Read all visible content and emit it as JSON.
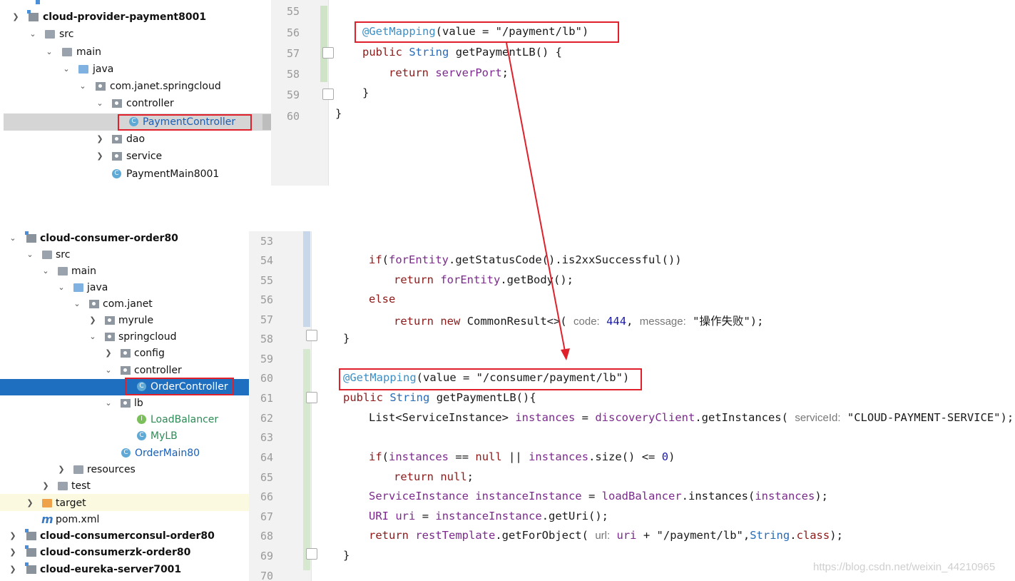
{
  "top_tree": {
    "items": [
      {
        "label": "cloud-provider-payment8001"
      },
      {
        "label": "src"
      },
      {
        "label": "main"
      },
      {
        "label": "java"
      },
      {
        "label": "com.janet.springcloud"
      },
      {
        "label": "controller"
      },
      {
        "label": "PaymentController"
      },
      {
        "label": "dao"
      },
      {
        "label": "service"
      },
      {
        "label": "PaymentMain8001"
      }
    ]
  },
  "top_editor": {
    "line_numbers": [
      "55",
      "56",
      "57",
      "58",
      "59",
      "60"
    ],
    "lines": {
      "l56_ann": "@GetMapping",
      "l56_rest": "(value = \"/payment/lb\")",
      "l57_kw": "public",
      "l57_type": "String",
      "l57_rest": "getPaymentLB() {",
      "l58_kw": "return",
      "l58_field": "serverPort",
      "l58_end": ";",
      "l59": "}",
      "l60": "}"
    }
  },
  "bottom_tree": {
    "items": [
      {
        "label": "cloud-consumer-order80"
      },
      {
        "label": "src"
      },
      {
        "label": "main"
      },
      {
        "label": "java"
      },
      {
        "label": "com.janet"
      },
      {
        "label": "myrule"
      },
      {
        "label": "springcloud"
      },
      {
        "label": "config"
      },
      {
        "label": "controller"
      },
      {
        "label": "OrderController"
      },
      {
        "label": "lb"
      },
      {
        "label": "LoadBalancer"
      },
      {
        "label": "MyLB"
      },
      {
        "label": "OrderMain80"
      },
      {
        "label": "resources"
      },
      {
        "label": "test"
      },
      {
        "label": "target"
      },
      {
        "label": "pom.xml"
      },
      {
        "label": "cloud-consumerconsul-order80"
      },
      {
        "label": "cloud-consumerzk-order80"
      },
      {
        "label": "cloud-eureka-server7001"
      }
    ]
  },
  "bottom_editor": {
    "line_numbers": [
      "53",
      "54",
      "55",
      "56",
      "57",
      "58",
      "59",
      "60",
      "61",
      "62",
      "63",
      "64",
      "65",
      "66",
      "67",
      "68",
      "69",
      "70"
    ],
    "lines": {
      "l54_kw": "if",
      "l54_a": "(",
      "l54_f": "forEntity",
      "l54_b": ".getStatusCode().is2xxSuccessful())",
      "l55_kw": "return",
      "l55_f": "forEntity",
      "l55_b": ".getBody();",
      "l56_kw": "else",
      "l57_kw1": "return",
      "l57_kw2": "new",
      "l57_a": "CommonResult<>(",
      "l57_h1": "code:",
      "l57_n": "444",
      "l57_c": ",",
      "l57_h2": "message:",
      "l57_s": "\"操作失败\");",
      "l58": "}",
      "l60_ann": "@GetMapping",
      "l60_rest": "(value = \"/consumer/payment/lb\")",
      "l61_kw": "public",
      "l61_type": "String",
      "l61_rest": "getPaymentLB(){",
      "l62_a": "List<ServiceInstance>",
      "l62_f": "instances",
      "l62_b": "=",
      "l62_f2": "discoveryClient",
      "l62_c": ".getInstances(",
      "l62_h": "serviceId:",
      "l62_s": "\"CLOUD-PAYMENT-SERVICE\");",
      "l64_kw": "if",
      "l64_a": "(",
      "l64_f": "instances",
      "l64_b": "==",
      "l64_kw2": "null",
      "l64_c": "||",
      "l64_f2": "instances",
      "l64_d": ".size() <=",
      "l64_n": "0",
      "l64_e": ")",
      "l65_kw": "return",
      "l65_kw2": "null",
      "l65_e": ";",
      "l66_t": "ServiceInstance",
      "l66_f": "instanceInstance",
      "l66_b": "=",
      "l66_f2": "loadBalancer",
      "l66_c": ".instances(",
      "l66_f3": "instances",
      "l66_e": ");",
      "l67_t": "URI",
      "l67_f": "uri",
      "l67_b": "=",
      "l67_f2": "instanceInstance",
      "l67_c": ".getUri();",
      "l68_kw": "return",
      "l68_f": "restTemplate",
      "l68_c": ".getForObject(",
      "l68_h": "url:",
      "l68_f2": "uri",
      "l68_d": "+",
      "l68_s": "\"/payment/lb\"",
      "l68_e": ",",
      "l68_t": "String",
      "l68_g": ".",
      "l68_kw2": "class",
      "l68_z": ");",
      "l69": "}"
    }
  },
  "watermark": "https://blog.csdn.net/weixin_44210965",
  "colors": {
    "highlight_box": "#e0202a",
    "selected_row": "#1f6fc0",
    "arrow": "#e0202a"
  }
}
